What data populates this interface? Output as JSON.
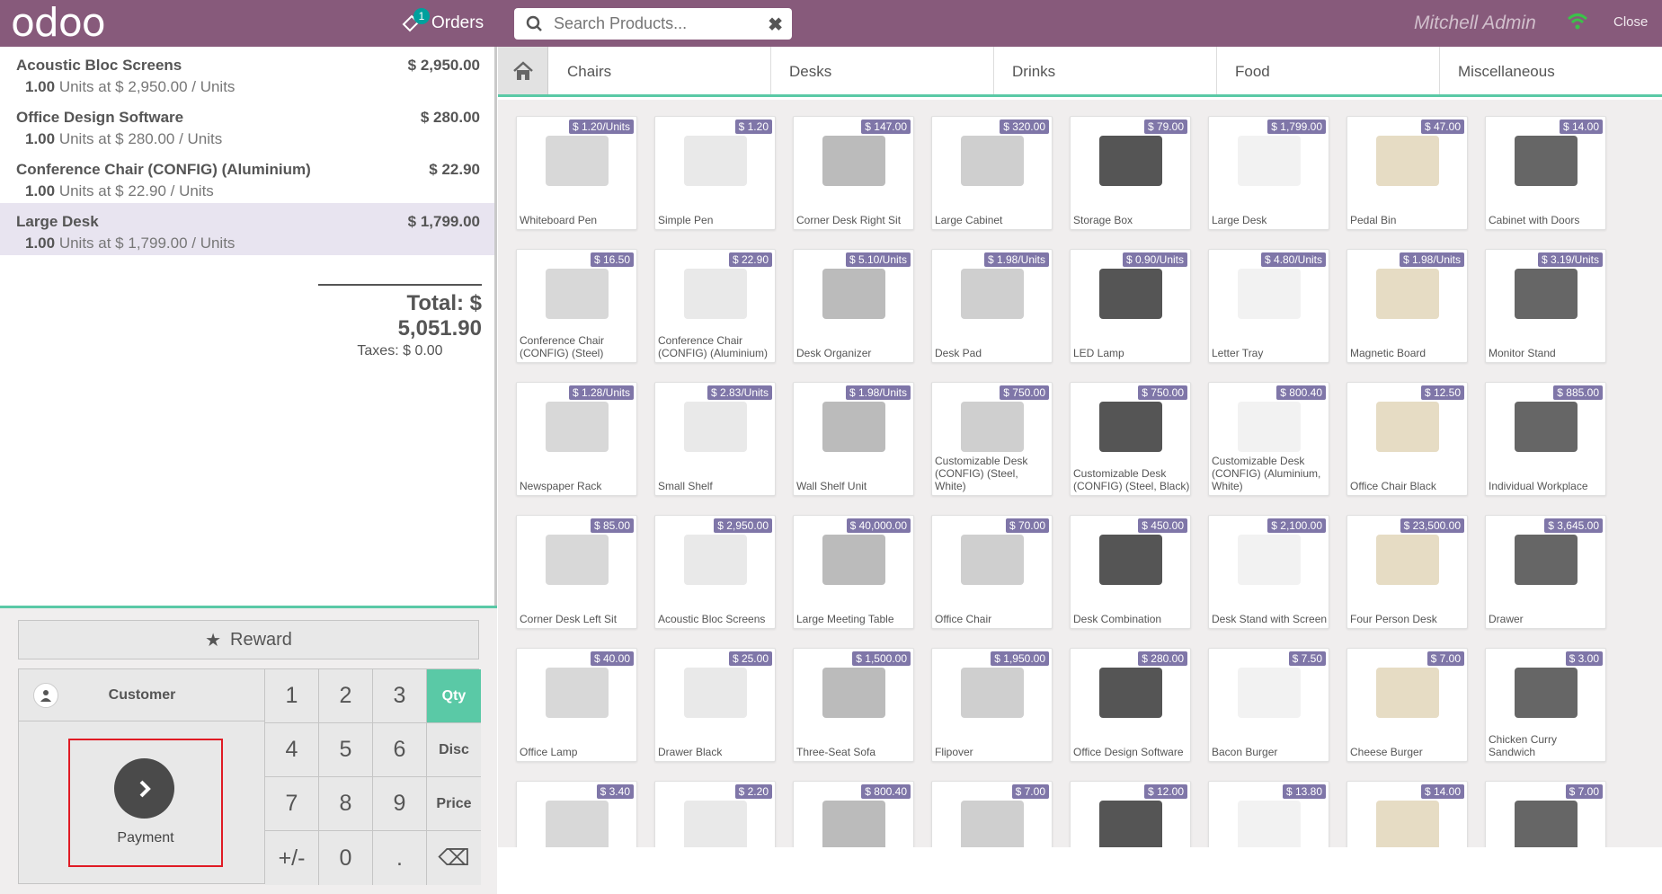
{
  "header": {
    "logo": "odoo",
    "orders_label": "Orders",
    "orders_badge": "1",
    "search_placeholder": "Search Products...",
    "user": "Mitchell Admin",
    "close_label": "Close"
  },
  "orderlines": [
    {
      "name": "Acoustic Bloc Screens",
      "price": "$ 2,950.00",
      "qty": "1.00",
      "info": "Units at $ 2,950.00 / Units"
    },
    {
      "name": "Office Design Software",
      "price": "$ 280.00",
      "qty": "1.00",
      "info": "Units at $ 280.00 / Units"
    },
    {
      "name": "Conference Chair (CONFIG) (Aluminium)",
      "price": "$ 22.90",
      "qty": "1.00",
      "info": "Units at $ 22.90 / Units"
    },
    {
      "name": "Large Desk",
      "price": "$ 1,799.00",
      "qty": "1.00",
      "info": "Units at $ 1,799.00 / Units"
    }
  ],
  "totals": {
    "total": "Total: $ 5,051.90",
    "taxes": "Taxes: $ 0.00"
  },
  "controls": {
    "reward": "Reward",
    "customer": "Customer",
    "payment": "Payment",
    "keys": [
      "1",
      "2",
      "3",
      "Qty",
      "4",
      "5",
      "6",
      "Disc",
      "7",
      "8",
      "9",
      "Price",
      "+/-",
      "0",
      ".",
      "⌫"
    ]
  },
  "categories": [
    "Chairs",
    "Desks",
    "Drinks",
    "Food",
    "Miscellaneous"
  ],
  "products": [
    {
      "name": "Whiteboard Pen",
      "price": "$ 1.20/Units"
    },
    {
      "name": "Simple Pen",
      "price": "$ 1.20"
    },
    {
      "name": "Corner Desk Right Sit",
      "price": "$ 147.00"
    },
    {
      "name": "Large Cabinet",
      "price": "$ 320.00"
    },
    {
      "name": "Storage Box",
      "price": "$ 79.00"
    },
    {
      "name": "Large Desk",
      "price": "$ 1,799.00"
    },
    {
      "name": "Pedal Bin",
      "price": "$ 47.00"
    },
    {
      "name": "Cabinet with Doors",
      "price": "$ 14.00"
    },
    {
      "name": "Conference Chair (CONFIG) (Steel)",
      "price": "$ 16.50"
    },
    {
      "name": "Conference Chair (CONFIG) (Aluminium)",
      "price": "$ 22.90"
    },
    {
      "name": "Desk Organizer",
      "price": "$ 5.10/Units"
    },
    {
      "name": "Desk Pad",
      "price": "$ 1.98/Units"
    },
    {
      "name": "LED Lamp",
      "price": "$ 0.90/Units"
    },
    {
      "name": "Letter Tray",
      "price": "$ 4.80/Units"
    },
    {
      "name": "Magnetic Board",
      "price": "$ 1.98/Units"
    },
    {
      "name": "Monitor Stand",
      "price": "$ 3.19/Units"
    },
    {
      "name": "Newspaper Rack",
      "price": "$ 1.28/Units"
    },
    {
      "name": "Small Shelf",
      "price": "$ 2.83/Units"
    },
    {
      "name": "Wall Shelf Unit",
      "price": "$ 1.98/Units"
    },
    {
      "name": "Customizable Desk (CONFIG) (Steel, White)",
      "price": "$ 750.00"
    },
    {
      "name": "Customizable Desk (CONFIG) (Steel, Black)",
      "price": "$ 750.00"
    },
    {
      "name": "Customizable Desk (CONFIG) (Aluminium, White)",
      "price": "$ 800.40"
    },
    {
      "name": "Office Chair Black",
      "price": "$ 12.50"
    },
    {
      "name": "Individual Workplace",
      "price": "$ 885.00"
    },
    {
      "name": "Corner Desk Left Sit",
      "price": "$ 85.00"
    },
    {
      "name": "Acoustic Bloc Screens",
      "price": "$ 2,950.00"
    },
    {
      "name": "Large Meeting Table",
      "price": "$ 40,000.00"
    },
    {
      "name": "Office Chair",
      "price": "$ 70.00"
    },
    {
      "name": "Desk Combination",
      "price": "$ 450.00"
    },
    {
      "name": "Desk Stand with Screen",
      "price": "$ 2,100.00"
    },
    {
      "name": "Four Person Desk",
      "price": "$ 23,500.00"
    },
    {
      "name": "Drawer",
      "price": "$ 3,645.00"
    },
    {
      "name": "Office Lamp",
      "price": "$ 40.00"
    },
    {
      "name": "Drawer Black",
      "price": "$ 25.00"
    },
    {
      "name": "Three-Seat Sofa",
      "price": "$ 1,500.00"
    },
    {
      "name": "Flipover",
      "price": "$ 1,950.00"
    },
    {
      "name": "Office Design Software",
      "price": "$ 280.00"
    },
    {
      "name": "Bacon Burger",
      "price": "$ 7.50"
    },
    {
      "name": "Cheese Burger",
      "price": "$ 7.00"
    },
    {
      "name": "Chicken Curry Sandwich",
      "price": "$ 3.00"
    },
    {
      "name": "",
      "price": "$ 3.40"
    },
    {
      "name": "",
      "price": "$ 2.20"
    },
    {
      "name": "",
      "price": "$ 800.40"
    },
    {
      "name": "",
      "price": "$ 7.00"
    },
    {
      "name": "",
      "price": "$ 12.00"
    },
    {
      "name": "",
      "price": "$ 13.80"
    },
    {
      "name": "",
      "price": "$ 14.00"
    },
    {
      "name": "",
      "price": "$ 7.00"
    }
  ]
}
